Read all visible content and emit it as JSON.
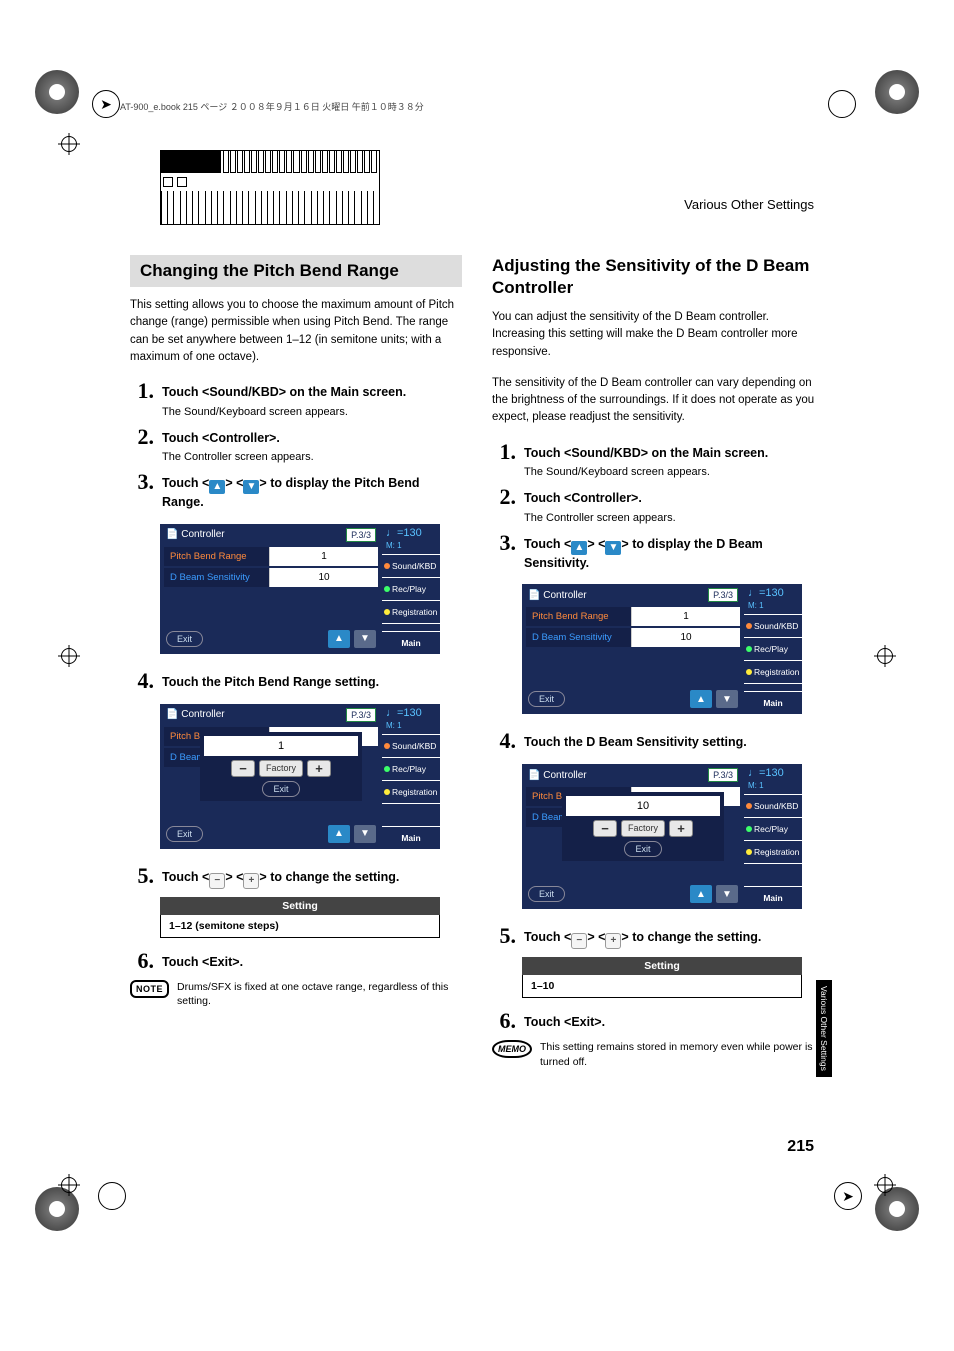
{
  "page_header_info": "AT-900_e.book 215 ページ ２００８年９月１６日 火曜日 午前１０時３８分",
  "header_right": "Various Other Settings",
  "side_tab": "Various Other Settings",
  "page_number": "215",
  "left": {
    "title": "Changing the Pitch Bend Range",
    "intro": "This setting allows you to choose the maximum amount of Pitch change (range) permissible when using Pitch Bend. The range can be set anywhere between 1–12 (in semitone units; with a maximum of one octave).",
    "step1": {
      "text": "Touch <Sound/KBD> on the Main screen.",
      "sub": "The Sound/Keyboard screen appears."
    },
    "step2": {
      "text": "Touch <Controller>.",
      "sub": "The Controller screen appears."
    },
    "step3_pre": "Touch <",
    "step3_mid": "> <",
    "step3_post": "> to display the Pitch Bend Range.",
    "step4": "Touch the Pitch Bend Range setting.",
    "step5_pre": "Touch <",
    "step5_mid": "> <",
    "step5_post": "> to change the setting.",
    "step6": "Touch <Exit>.",
    "setting_head": "Setting",
    "setting_val": "1–12 (semitone steps)",
    "note": "Drums/SFX is fixed at one octave range, regardless of this setting.",
    "note_label": "NOTE"
  },
  "right": {
    "title": "Adjusting the Sensitivity of the D Beam Controller",
    "intro1": "You can adjust the sensitivity of the D Beam controller. Increasing this setting will make the D Beam controller more responsive.",
    "intro2": "The sensitivity of the D Beam controller can vary depending on the brightness of the surroundings. If it does not operate as you expect, please readjust the sensitivity.",
    "step1": {
      "text": "Touch <Sound/KBD> on the Main screen.",
      "sub": "The Sound/Keyboard screen appears."
    },
    "step2": {
      "text": "Touch <Controller>.",
      "sub": "The Controller screen appears."
    },
    "step3_pre": "Touch <",
    "step3_mid": "> <",
    "step3_post": "> to display the D Beam Sensitivity.",
    "step4": "Touch the D Beam Sensitivity setting.",
    "step5_pre": "Touch <",
    "step5_mid": "> <",
    "step5_post": "> to change the setting.",
    "step6": "Touch <Exit>.",
    "setting_head": "Setting",
    "setting_val": "1–10",
    "memo": "This setting remains stored in memory even while power is turned off.",
    "memo_label": "MEMO"
  },
  "scr": {
    "title": "Controller",
    "page": "P.3/3",
    "tempo": "=130",
    "meas": "M:    1",
    "row1_label": "Pitch Bend Range",
    "row1_val": "1",
    "row2_label": "D Beam Sensitivity",
    "row2_val": "10",
    "row2_label_short": "D Beam",
    "exit": "Exit",
    "side1": "Sound/KBD",
    "side2": "Rec/Play",
    "side3": "Registration",
    "side4": "Main",
    "factory": "Factory",
    "popup_val_left": "1",
    "popup_val_right": "10"
  }
}
